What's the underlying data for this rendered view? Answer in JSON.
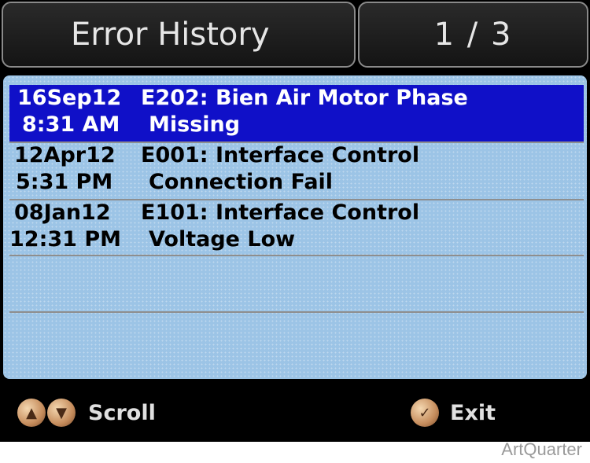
{
  "header": {
    "title": "Error History",
    "page_indicator": "1 / 3"
  },
  "errors": [
    {
      "date": "16Sep12",
      "time": "8:31 AM",
      "code_line1": "E202: Bien Air Motor Phase",
      "code_line2": "Missing",
      "selected": true
    },
    {
      "date": "12Apr12",
      "time": "5:31 PM",
      "code_line1": "E001: Interface Control",
      "code_line2": "Connection Fail",
      "selected": false
    },
    {
      "date": "08Jan12",
      "time": "12:31 PM",
      "code_line1": "E101: Interface Control",
      "code_line2": "Voltage Low",
      "selected": false
    }
  ],
  "footer": {
    "scroll_label": "Scroll",
    "exit_label": "Exit",
    "scroll_icons": [
      "up-arrow-icon",
      "down-arrow-icon"
    ],
    "exit_icon": "checkmark-icon"
  },
  "watermark": "ArtQuarter",
  "colors": {
    "selection": "#1010c8",
    "list_background": "#9cc4e6",
    "screen_background": "#000000"
  }
}
